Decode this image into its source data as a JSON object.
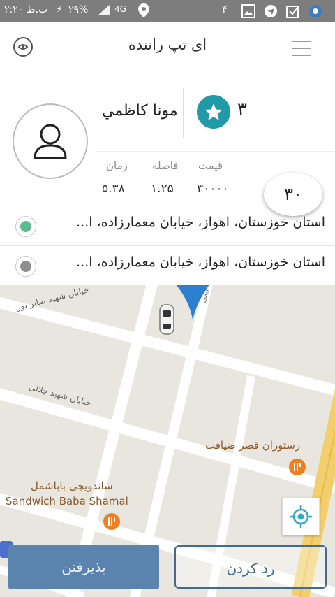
{
  "status_bar": {
    "time": "۲:۲۰ ب.ظ",
    "battery": "۲۹%",
    "network": "4G",
    "notification_count": "۴"
  },
  "app_bar": {
    "title": "ای تپ راننده"
  },
  "passenger": {
    "name": "مونا کاظمي",
    "rating": "۳"
  },
  "stats": {
    "price_label": "قیمت",
    "price_value": "۳۰۰۰۰",
    "distance_label": "فاصله",
    "distance_value": "۱.۲۵",
    "time_label": "زمان",
    "time_value": "۵.۳۸"
  },
  "eta_badge": "۳۰",
  "addresses": {
    "origin": "استان خوزستان، اهواز، خیابان معمارزاده، ا...",
    "destination": "استان خوزستان، اهواز، خیابان معمارزاده، ا..."
  },
  "map": {
    "street_1": "خیابان شهید صابر بور",
    "street_2": "خیابان شهید جلالی",
    "street_3": "ایمی",
    "poi_1": "رستوران قصر ضیافت",
    "poi_2_fa": "ساندویچی باباشمل",
    "poi_2_en": "Sandwich Baba Shamal"
  },
  "actions": {
    "accept": "پذیرفتن",
    "reject": "رد کردن"
  },
  "colors": {
    "accent_teal": "#1f9aa6",
    "origin_dot": "#5dbb8f",
    "destination_dot": "#8f8f8f",
    "accept_bg": "#5a83ad",
    "reject_border": "#3f6b96",
    "map_bg": "#e9e6df",
    "pin_blue": "#2e7fd0"
  }
}
